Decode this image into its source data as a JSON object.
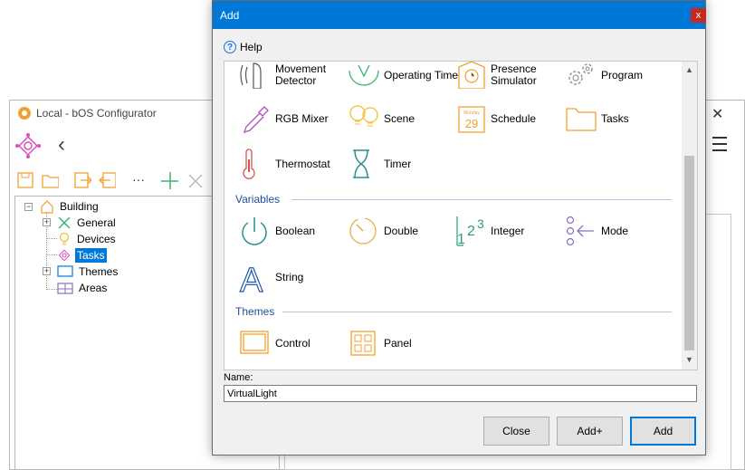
{
  "background_window": {
    "title": "Local - bOS Configurator",
    "close_glyph": "✕",
    "back_glyph": "‹",
    "more_glyph": "···",
    "tree": [
      {
        "label": "Building",
        "icon": "house-icon"
      },
      {
        "label": "General",
        "icon": "tools-icon"
      },
      {
        "label": "Devices",
        "icon": "lightbulb-icon"
      },
      {
        "label": "Tasks",
        "icon": "network-icon",
        "selected": true
      },
      {
        "label": "Themes",
        "icon": "monitor-icon"
      },
      {
        "label": "Areas",
        "icon": "areas-icon"
      }
    ]
  },
  "dialog": {
    "title": "Add",
    "close_glyph": "x",
    "help_label": "Help",
    "help_glyph": "?",
    "items_row1": [
      {
        "label1": "Movement",
        "label2": "Detector",
        "icon": "movement-detector-icon"
      },
      {
        "label1": "Operating Time",
        "icon": "operating-time-icon"
      },
      {
        "label1": "Presence",
        "label2": "Simulator",
        "icon": "presence-simulator-icon"
      },
      {
        "label1": "Program",
        "icon": "program-gears-icon"
      }
    ],
    "items_row2": [
      {
        "label": "RGB Mixer",
        "icon": "pipette-icon"
      },
      {
        "label": "Scene",
        "icon": "scene-bulbs-icon"
      },
      {
        "label": "Schedule",
        "icon": "calendar-icon"
      },
      {
        "label": "Tasks",
        "icon": "folder-icon"
      }
    ],
    "items_row3": [
      {
        "label": "Thermostat",
        "icon": "thermometer-icon"
      },
      {
        "label": "Timer",
        "icon": "hourglass-icon"
      }
    ],
    "section_variables": "Variables",
    "variables_row1": [
      {
        "label": "Boolean",
        "icon": "power-icon"
      },
      {
        "label": "Double",
        "icon": "gauge-icon"
      },
      {
        "label": "Integer",
        "icon": "integer-icon"
      },
      {
        "label": "Mode",
        "icon": "mode-icon"
      }
    ],
    "variables_row2": [
      {
        "label": "String",
        "icon": "letter-a-icon"
      }
    ],
    "integer_glyphs": {
      "one": "1",
      "two": "2",
      "three": "3"
    },
    "calendar": {
      "month": "Monday",
      "day": "29"
    },
    "string_glyph": "A",
    "section_themes": "Themes",
    "themes_row": [
      {
        "label": "Control",
        "icon": "control-frame-icon"
      },
      {
        "label": "Panel",
        "icon": "panel-grid-icon"
      }
    ],
    "name_label": "Name:",
    "name_value": "VirtualLight",
    "buttons": {
      "close": "Close",
      "add_plus": "Add+",
      "add": "Add"
    },
    "scroll_up": "▲",
    "scroll_down": "▼"
  },
  "colors": {
    "accent": "#0078d7",
    "icon_orange": "#f0a030",
    "icon_teal": "#2a8f8f",
    "icon_green": "#3cb371"
  }
}
